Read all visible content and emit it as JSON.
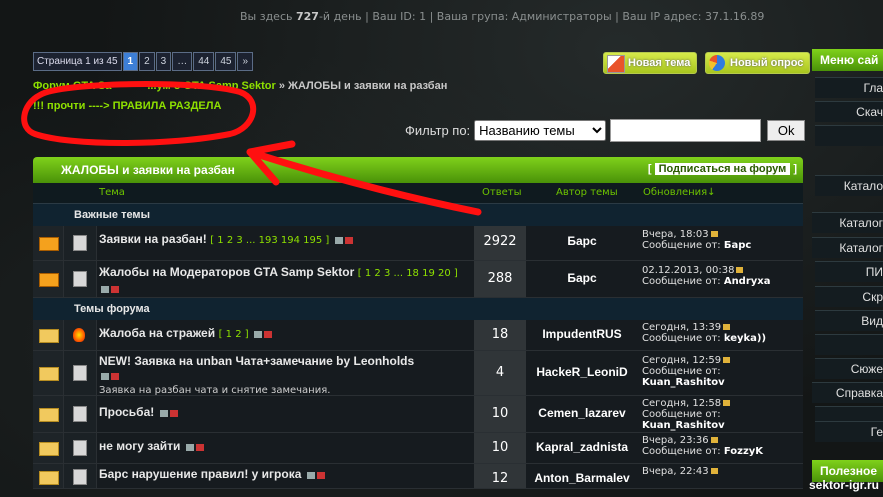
{
  "topbar": {
    "prefix": "Вы здесь",
    "days": "727",
    "days_suffix": "-й день | Ваш ID: 1 | Ваша група: Администраторы | Ваш IP адрес: 37.1.16.89"
  },
  "pager": {
    "label": "Страница 1 из 45",
    "pages": [
      "1",
      "2",
      "3",
      "…",
      "44",
      "45",
      "»"
    ],
    "current": "1"
  },
  "buttons": {
    "new_topic": "Новая тема",
    "new_poll": "Новый опрос"
  },
  "breadcrumb": {
    "part1": "Форум GTA Sa",
    "part2": "...ум о GTA Samp Sektor",
    "sep": " » ",
    "current": "ЖАЛОБЫ и заявки на разбан"
  },
  "rules_link": "!!! прочти ----> ПРАВИЛА РАЗДЕЛА",
  "filter": {
    "label": "Фильтр по:",
    "selected": "Названию темы",
    "ok": "Ok"
  },
  "forum": {
    "title": "ЖАЛОБЫ и заявки на разбан",
    "subscribe": "Подписаться на форум",
    "columns": {
      "topic": "Тема",
      "replies": "Ответы",
      "author": "Автор темы",
      "updates": "Обновления↓"
    },
    "section_important": "Важные темы",
    "section_topics": "Темы форума",
    "important": [
      {
        "title": "Заявки на разбан!",
        "pages": "[ 1 2 3 ... 193 194 195 ]",
        "replies": "2922",
        "author": "Барс",
        "updated": "Вчера, 18:03",
        "last_by_label": "Сообщение от:",
        "last_by": "Барс"
      },
      {
        "title": "Жалобы на Модераторов GTA Samp Sektor",
        "pages": "[ 1 2 3 ... 18 19 20 ]",
        "replies": "288",
        "author": "Барс",
        "updated": "02.12.2013, 00:38",
        "last_by_label": "Сообщение от:",
        "last_by": "Andryxa"
      }
    ],
    "topics": [
      {
        "title": "Жалоба на стражей",
        "pages": "[ 1 2 ]",
        "desc": "",
        "replies": "18",
        "author": "ImpudentRUS",
        "updated": "Сегодня, 13:39",
        "last_by_label": "Сообщение от:",
        "last_by": "keyka))"
      },
      {
        "title": "NEW! Заявка на unban Чата+замечание by Leonholds",
        "pages": "",
        "desc": "Заявка на разбан чата и снятие замечания.",
        "replies": "4",
        "author": "HackeR_LeoniD",
        "updated": "Сегодня, 12:59",
        "last_by_label": "Сообщение от:",
        "last_by": "Kuan_Rashitov"
      },
      {
        "title": "Просьба!",
        "pages": "",
        "desc": "",
        "replies": "10",
        "author": "Cemen_lazarev",
        "updated": "Сегодня, 12:58",
        "last_by_label": "Сообщение от:",
        "last_by": "Kuan_Rashitov"
      },
      {
        "title": "не могу зайти",
        "pages": "",
        "desc": "",
        "replies": "10",
        "author": "Kapral_zadnista",
        "updated": "Вчера, 23:36",
        "last_by_label": "Сообщение от:",
        "last_by": "FozzyK"
      },
      {
        "title": "Барс нарушение правил! у игрока",
        "pages": "",
        "desc": "",
        "replies": "12",
        "author": "Anton_Barmalev",
        "updated": "Вчера, 22:43",
        "last_by_label": "",
        "last_by": ""
      }
    ]
  },
  "side": {
    "menu_title": "Меню сай",
    "items": [
      "Гла",
      "Скач",
      "",
      "Катало",
      "Каталог",
      "Каталог",
      "ПИ",
      "Скр",
      "Вид",
      "",
      "Сюже",
      "Справка",
      "",
      "Ге"
    ],
    "useful_title": "Полезное"
  },
  "site_name": "sektor-igr.ru"
}
